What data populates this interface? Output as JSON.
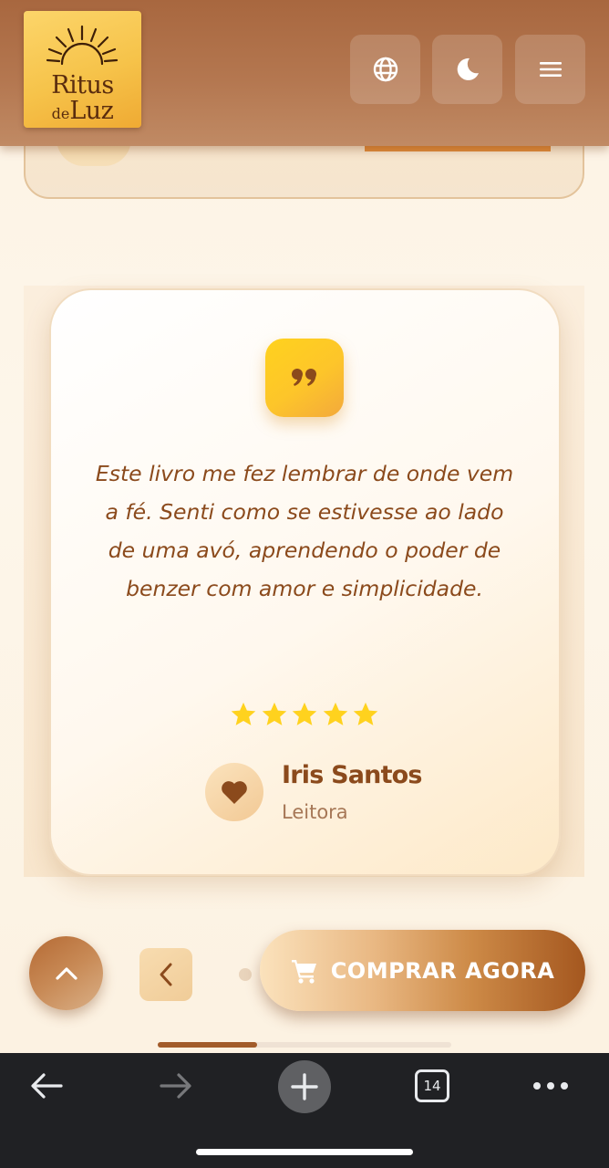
{
  "header": {
    "logo": {
      "line1": "Ritus",
      "line2_small": "de",
      "line2_big": "Luz",
      "icon": "rising-sun-icon"
    },
    "buttons": [
      {
        "name": "language-button",
        "icon": "globe-icon"
      },
      {
        "name": "theme-toggle-button",
        "icon": "moon-icon"
      },
      {
        "name": "menu-button",
        "icon": "hamburger-menu-icon"
      }
    ]
  },
  "testimonial": {
    "quote_icon": "quote-icon",
    "text": "Este livro me fez lembrar de onde vem a fé. Senti como se estivesse ao lado de uma avó, aprendendo o poder de benzer com amor e simplicidade.",
    "rating": 5,
    "rating_max": 5,
    "author": {
      "name": "Iris Santos",
      "role": "Leitora",
      "avatar_icon": "heart-icon"
    }
  },
  "controls": {
    "scroll_top_icon": "chevron-up-icon",
    "prev_icon": "chevron-left-icon",
    "buy_button": {
      "label": "COMPRAR AGORA",
      "icon": "cart-icon"
    },
    "carousel_progress": 0.34
  },
  "browser": {
    "back_icon": "arrow-left-icon",
    "forward_icon": "arrow-right-icon",
    "new_tab_icon": "plus-icon",
    "tab_count": "14",
    "more_icon": "more-dots-icon"
  },
  "colors": {
    "brand_brown": "#8b4a1c",
    "header_brown": "#a8673f",
    "gold": "#fdc52a",
    "star": "#ffd21e",
    "browser_bar": "#202124"
  }
}
